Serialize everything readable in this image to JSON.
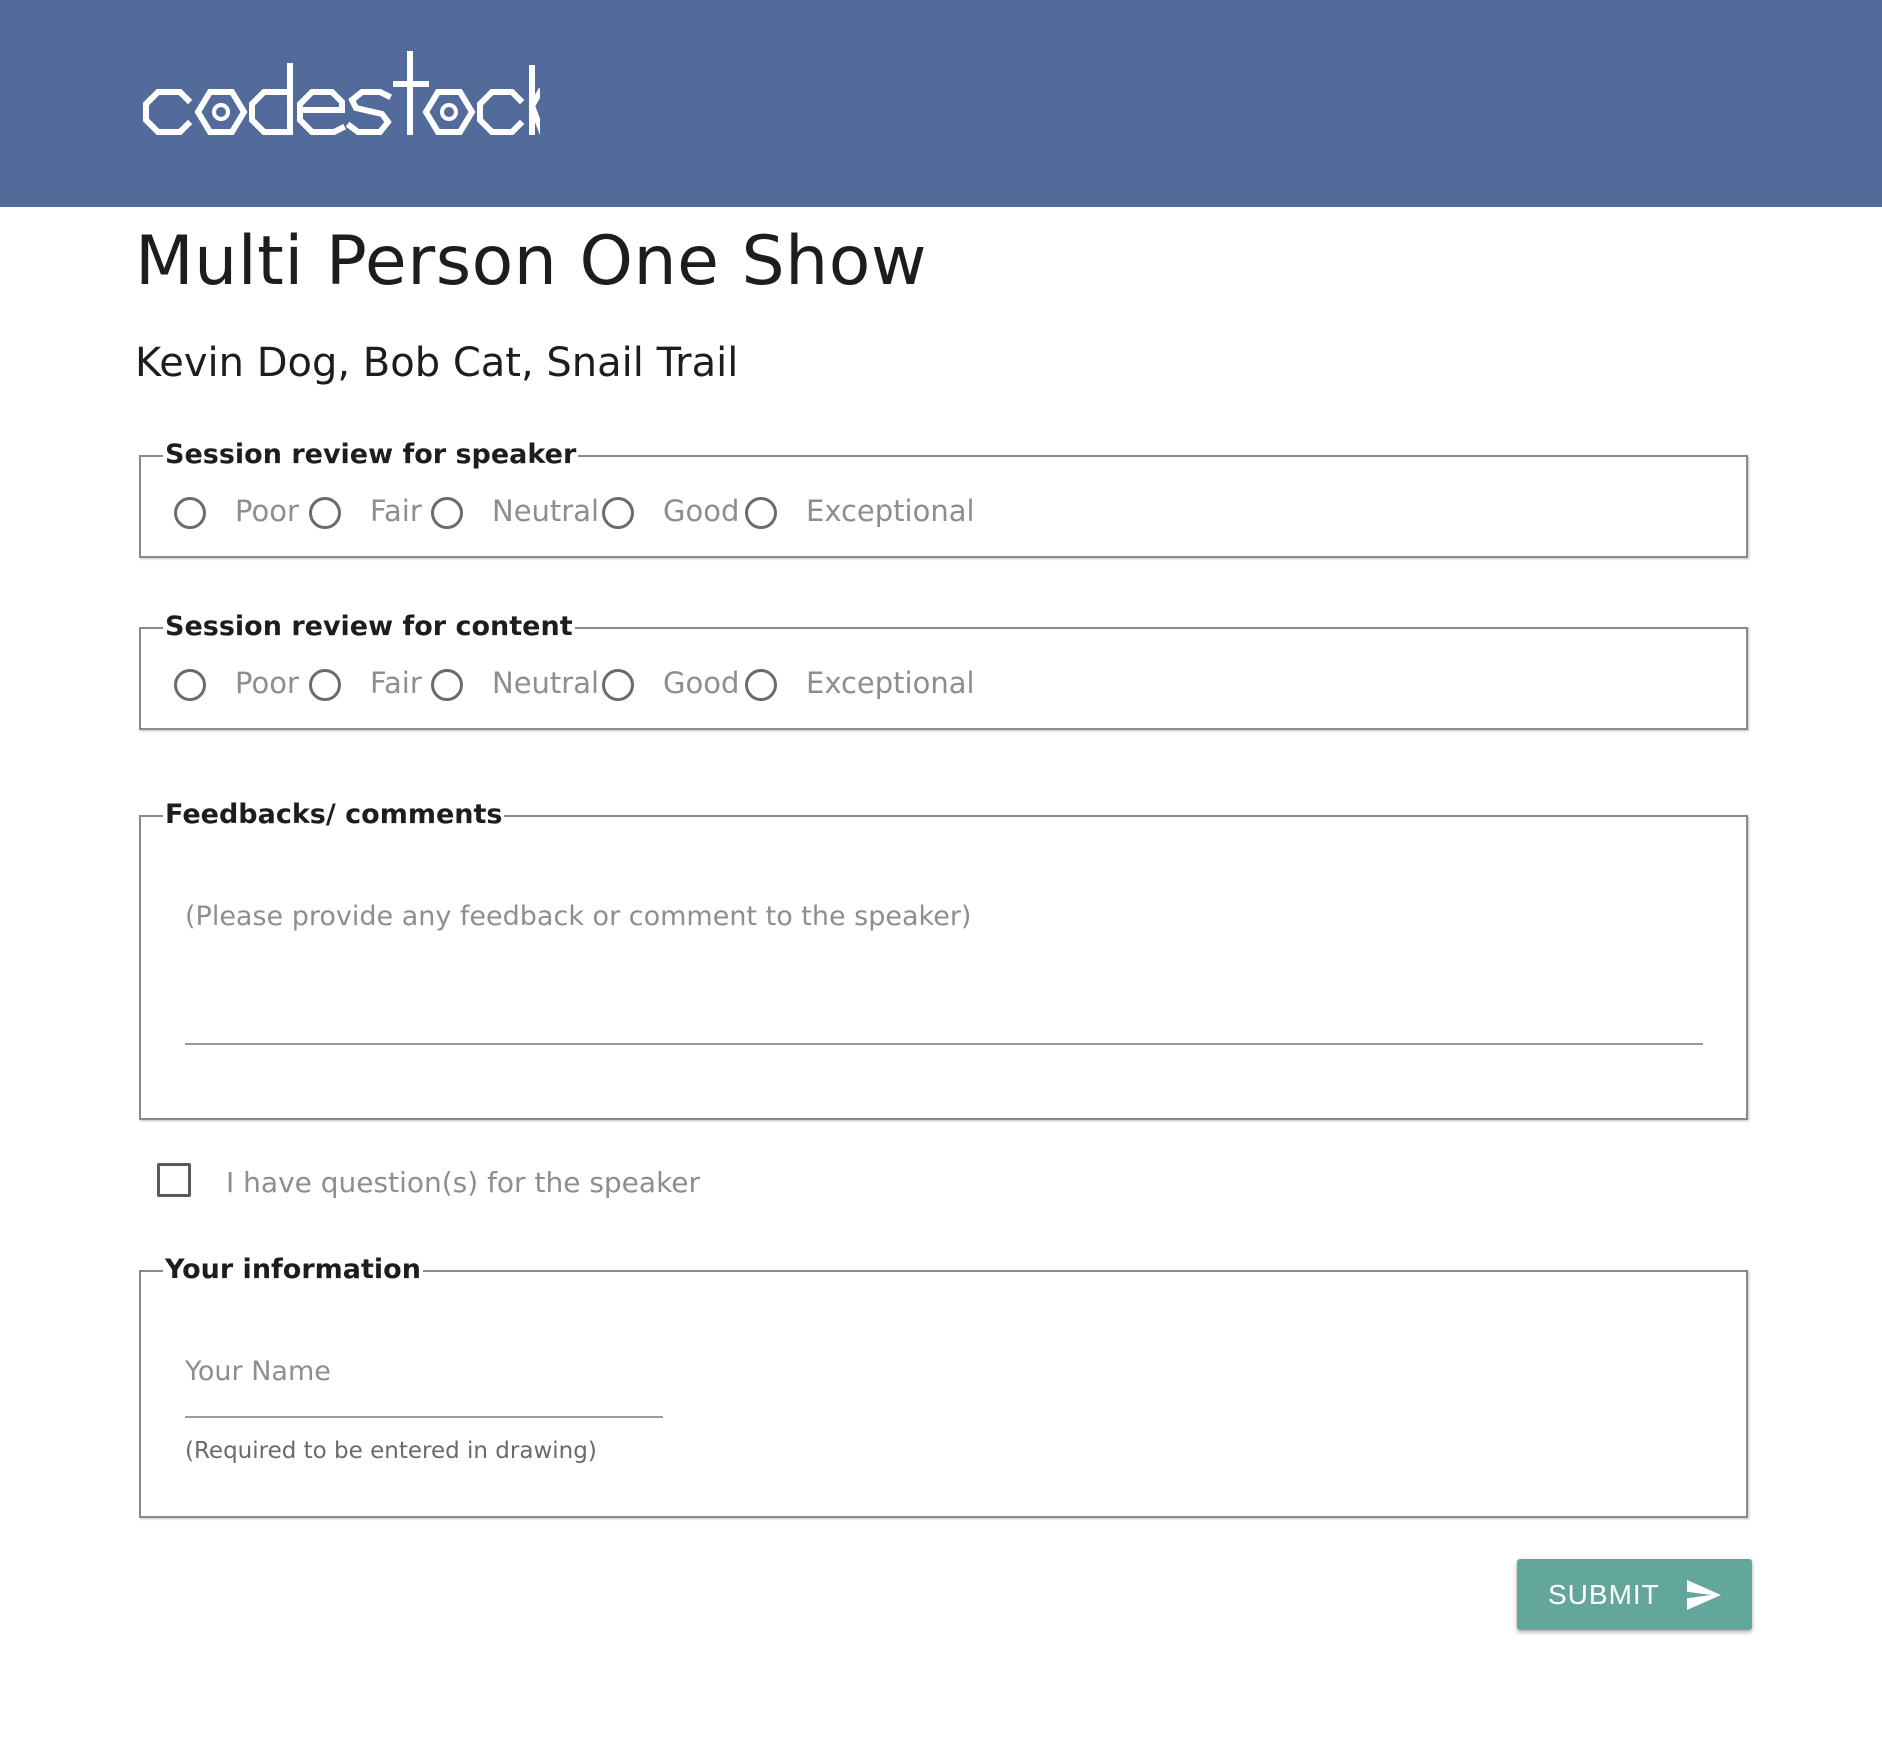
{
  "header": {
    "logo_text": "codestock",
    "background_color": "#536b9a"
  },
  "session": {
    "title": "Multi Person One Show",
    "speakers": "Kevin Dog, Bob Cat, Snail Trail"
  },
  "speaker_review": {
    "legend": "Session review for speaker",
    "options": [
      "Poor",
      "Fair",
      "Neutral",
      "Good",
      "Exceptional"
    ]
  },
  "content_review": {
    "legend": "Session review for content",
    "options": [
      "Poor",
      "Fair",
      "Neutral",
      "Good",
      "Exceptional"
    ]
  },
  "feedback": {
    "legend": "Feedbacks/ comments",
    "placeholder": "(Please provide any feedback or comment to the speaker)",
    "value": ""
  },
  "questions": {
    "label": "I have question(s) for the speaker",
    "checked": false
  },
  "your_info": {
    "legend": "Your information",
    "name_placeholder": "Your Name",
    "name_value": "",
    "hint": "(Required to be entered in drawing)"
  },
  "submit": {
    "label": "SUBMIT",
    "icon": "send-icon",
    "color": "#63a69b"
  }
}
